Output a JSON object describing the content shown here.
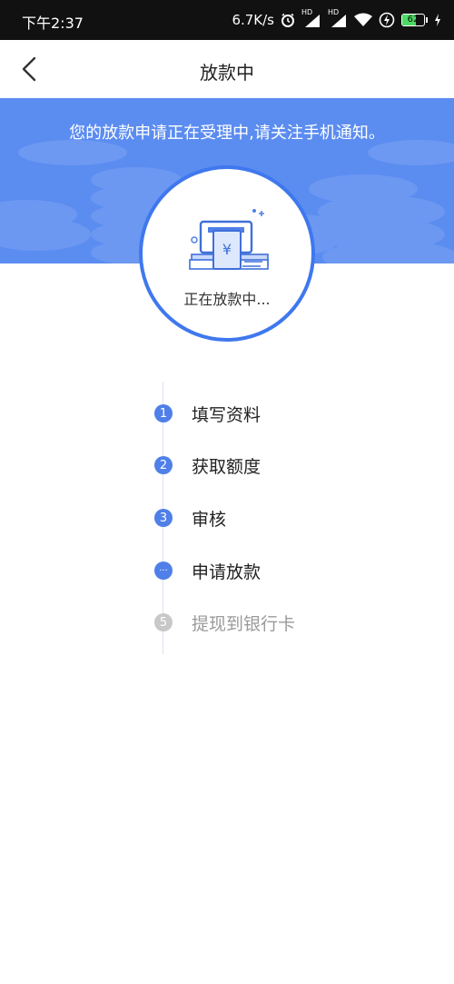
{
  "status_bar": {
    "time": "下午2:37",
    "network_speed": "6.7K/s",
    "hd1": "HD",
    "hd2": "HD",
    "battery_level": "62",
    "battery_fraction": 0.62,
    "icons": [
      "alarm-icon",
      "signal-icon",
      "wifi-icon",
      "power-saver-icon",
      "battery-icon",
      "charging-icon"
    ]
  },
  "header": {
    "title": "放款中",
    "back_icon": "chevron-left-icon"
  },
  "banner": {
    "message": "您的放款申请正在受理中,请关注手机通知。",
    "color": "#5b8cf0"
  },
  "status": {
    "label": "正在放款中...",
    "icon": "atm-cash-icon",
    "ring_color": "#3f78ee"
  },
  "steps": [
    {
      "marker": "1",
      "label": "填写资料",
      "state": "done"
    },
    {
      "marker": "2",
      "label": "获取额度",
      "state": "done"
    },
    {
      "marker": "3",
      "label": "审核",
      "state": "done"
    },
    {
      "marker": "···",
      "label": "申请放款",
      "state": "current"
    },
    {
      "marker": "5",
      "label": "提现到银行卡",
      "state": "pending"
    }
  ],
  "colors": {
    "accent": "#4f7fe8",
    "pending": "#c8c8c8"
  }
}
